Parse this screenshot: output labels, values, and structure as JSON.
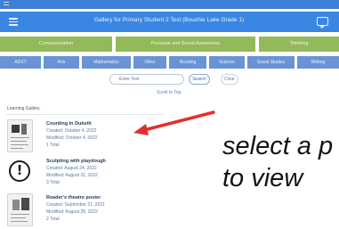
{
  "header": {
    "title": "Gallery for Primary Student 2 Test (Bouchie Lake Grade 1)"
  },
  "green_tabs": [
    "Communication",
    "Personal and Social Awareness",
    "Thinking"
  ],
  "blue_tabs": [
    "ADST",
    "Arts",
    "Mathematics",
    "Other",
    "Reading",
    "Science",
    "Social Studies",
    "Writing"
  ],
  "search": {
    "placeholder": "Enter Text",
    "search_label": "Search",
    "clear_label": "Clear"
  },
  "scroll_link": "Scroll to Top",
  "gallery_label": "Learning Gallery",
  "items": [
    {
      "title": "Counting in Duketh",
      "created": "Created: October 4, 2022",
      "modified": "Modified: October 4, 2022",
      "count": "1 Total"
    },
    {
      "title": "Sculpting with playdough",
      "created": "Created: August 24, 2022",
      "modified": "Modified: August 31, 2022",
      "count": "3 Total"
    },
    {
      "title": "Reader's theatre poster",
      "created": "Created: September 21, 2021",
      "modified": "Modified: August 28, 2022",
      "count": "2 Total"
    }
  ],
  "annotation": {
    "line1": "select a p",
    "line2": "to view"
  },
  "colors": {
    "header_blue": "#3b86e2",
    "tab_green": "#93b95a",
    "tab_blue": "#6a93d6",
    "arrow_red": "#e0322b"
  }
}
